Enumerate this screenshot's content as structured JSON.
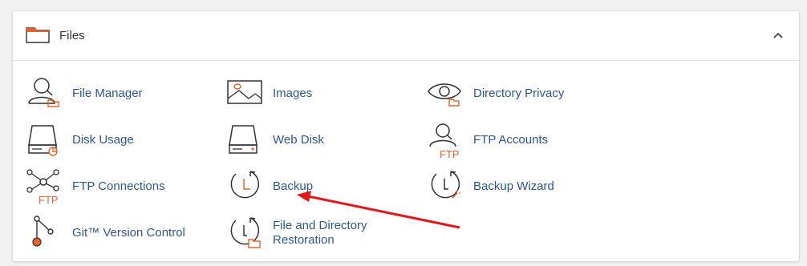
{
  "section": {
    "title": "Files",
    "icon": "folder-icon",
    "collapse_icon": "chevron-up-icon"
  },
  "items": [
    {
      "label": "File Manager",
      "icon": "file-manager-icon"
    },
    {
      "label": "Images",
      "icon": "images-icon"
    },
    {
      "label": "Directory Privacy",
      "icon": "directory-privacy-icon"
    },
    {
      "label": "Disk Usage",
      "icon": "disk-usage-icon"
    },
    {
      "label": "Web Disk",
      "icon": "web-disk-icon"
    },
    {
      "label": "FTP Accounts",
      "icon": "ftp-accounts-icon"
    },
    {
      "label": "FTP Connections",
      "icon": "ftp-connections-icon"
    },
    {
      "label": "Backup",
      "icon": "backup-icon"
    },
    {
      "label": "Backup Wizard",
      "icon": "backup-wizard-icon"
    },
    {
      "label": "Git™ Version Control",
      "icon": "git-icon"
    },
    {
      "label": "File and Directory Restoration",
      "icon": "restoration-icon"
    }
  ],
  "colors": {
    "accent_orange": "#e8632b",
    "link_blue": "#2d5796",
    "annotation_red": "#e0191b"
  }
}
